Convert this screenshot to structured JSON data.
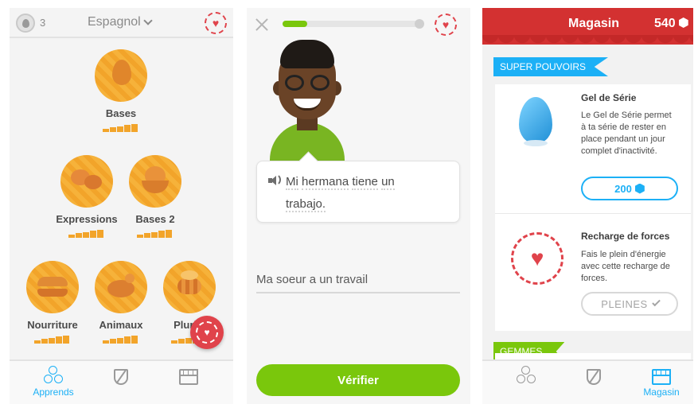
{
  "colors": {
    "accent_blue": "#1cb0f6",
    "green": "#7ac70c",
    "red": "#e0434b",
    "gold": "#f2a42a"
  },
  "learn": {
    "streak_icon": "flame-icon",
    "streak_count": "3",
    "language": "Espagnol",
    "skills": [
      {
        "label": "Bases",
        "icon": "egg-icon"
      },
      {
        "label": "Expressions",
        "icon": "speech-bubbles-icon"
      },
      {
        "label": "Bases 2",
        "icon": "chick-icon"
      },
      {
        "label": "Nourriture",
        "icon": "burger-icon"
      },
      {
        "label": "Animaux",
        "icon": "bird-icon"
      },
      {
        "label": "Pluriel",
        "icon": "bee-icon"
      }
    ],
    "tabs": {
      "learn": "Apprends"
    }
  },
  "lesson": {
    "progress": 0.18,
    "sentence_words": [
      "Mi",
      "hermana",
      "tiene",
      "un",
      "trabajo."
    ],
    "answer": "Ma soeur a un travail",
    "verify_label": "Vérifier"
  },
  "shop": {
    "title": "Magasin",
    "gems": "540",
    "section_powerups": "SUPER POUVOIRS",
    "streak_freeze": {
      "title": "Gel de Série",
      "desc": "Le Gel de Série permet à ta série de rester en place pendant un jour complet d'inactivité.",
      "price": "200"
    },
    "refill": {
      "title": "Recharge de forces",
      "desc": "Fais le plein d'énergie avec cette recharge de forces.",
      "status": "PLEINES"
    },
    "section_gems": "GEMMES",
    "tabs": {
      "shop": "Magasin"
    }
  }
}
